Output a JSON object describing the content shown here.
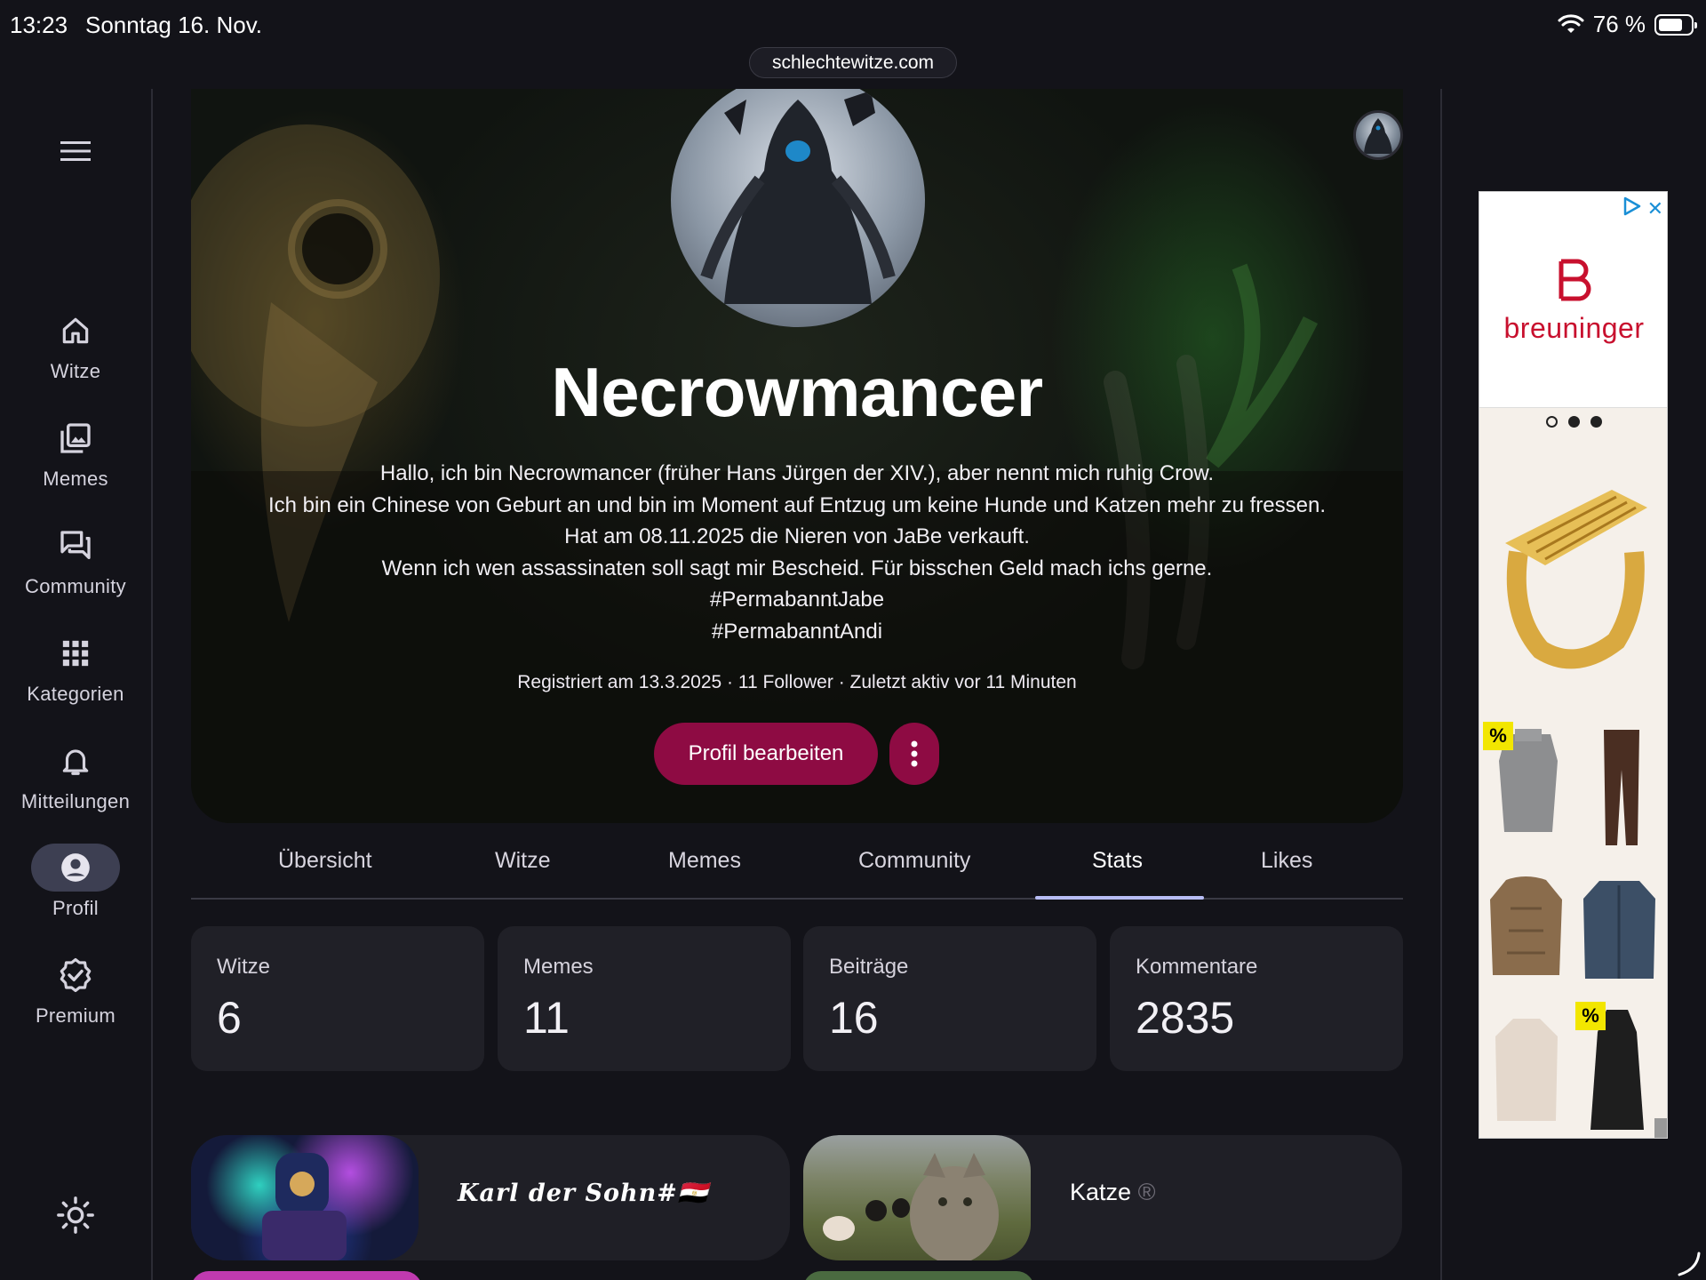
{
  "statusbar": {
    "time": "13:23",
    "date": "Sonntag 16. Nov.",
    "battery": "76 %",
    "battery_level": 0.76
  },
  "browser": {
    "url": "schlechtewitze.com"
  },
  "rail": {
    "items": [
      {
        "label": "Witze",
        "icon": "home-icon"
      },
      {
        "label": "Memes",
        "icon": "gallery-icon"
      },
      {
        "label": "Community",
        "icon": "forum-icon"
      },
      {
        "label": "Kategorien",
        "icon": "grid-icon"
      },
      {
        "label": "Mitteilungen",
        "icon": "bell-icon"
      },
      {
        "label": "Profil",
        "icon": "account-icon",
        "active": true
      },
      {
        "label": "Premium",
        "icon": "verified-icon"
      }
    ]
  },
  "profile": {
    "name": "Necrowmancer",
    "bio": [
      "Hallo, ich bin Necrowmancer (früher Hans Jürgen der XIV.), aber nennt mich ruhig Crow.",
      "Ich bin ein Chinese von Geburt an und bin im Moment auf Entzug um keine Hunde und Katzen mehr zu fressen.",
      "Hat am 08.11.2025 die Nieren von JaBe verkauft.",
      "Wenn ich wen assassinaten soll sagt mir Bescheid. Für bisschen Geld mach ichs gerne.",
      "#PermabanntJabe",
      "#PermabanntAndi"
    ],
    "meta": "Registriert am 13.3.2025 · 11 Follower · Zuletzt aktiv vor 11 Minuten",
    "edit_label": "Profil bearbeiten"
  },
  "tabs": [
    {
      "label": "Übersicht"
    },
    {
      "label": "Witze"
    },
    {
      "label": "Memes"
    },
    {
      "label": "Community"
    },
    {
      "label": "Stats",
      "active": true
    },
    {
      "label": "Likes"
    }
  ],
  "stats": [
    {
      "label": "Witze",
      "value": "6"
    },
    {
      "label": "Memes",
      "value": "11"
    },
    {
      "label": "Beiträge",
      "value": "16"
    },
    {
      "label": "Kommentare",
      "value": "2835"
    }
  ],
  "communities": [
    {
      "title": "Karl der Sohn#🇪🇬"
    },
    {
      "title": "Katze",
      "badge": "®"
    }
  ],
  "ad": {
    "brand": "breuninger",
    "sale_badge": "%"
  },
  "colors": {
    "accent": "#8e0b43",
    "tab_indicator": "#b8bdf5",
    "background": "#131319",
    "card": "#202027"
  }
}
